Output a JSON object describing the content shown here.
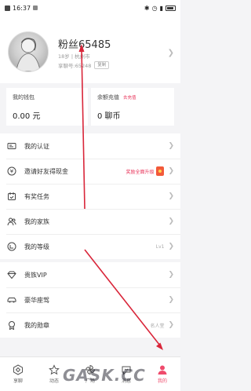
{
  "status_bar": {
    "time": "16:37"
  },
  "profile": {
    "nickname": "粉丝65485",
    "subinfo": "18岁 | 杭州市",
    "id_line": "享聊号:6​5248",
    "copy_label": "复制"
  },
  "wallet": {
    "title": "我的钱包",
    "value": "0.00 元"
  },
  "recharge": {
    "title": "余额充值",
    "tag": "去充值",
    "value": "0 聊币"
  },
  "menu_group_1": [
    {
      "label": "我的认证",
      "icon": "id-card-icon",
      "extra": ""
    },
    {
      "label": "邀请好友得现金",
      "icon": "yen-icon",
      "extra": "奖励全面升级"
    },
    {
      "label": "有奖任务",
      "icon": "calendar-icon",
      "extra": ""
    },
    {
      "label": "我的家族",
      "icon": "family-icon",
      "extra": ""
    },
    {
      "label": "我的等级",
      "icon": "level-icon",
      "extra": "Lv1"
    }
  ],
  "menu_group_2": [
    {
      "label": "贵族VIP",
      "icon": "diamond-icon",
      "extra": ""
    },
    {
      "label": "豪华座驾",
      "icon": "car-icon",
      "extra": ""
    },
    {
      "label": "我的勋章",
      "icon": "medal-icon",
      "extra": "名人堂"
    }
  ],
  "tabs": [
    {
      "label": "享聊",
      "icon": "hexagon-icon"
    },
    {
      "label": "动态",
      "icon": "star-icon"
    },
    {
      "label": "广场",
      "icon": "pinwheel-icon"
    },
    {
      "label": "消息",
      "icon": "message-icon"
    },
    {
      "label": "我的",
      "icon": "person-icon"
    }
  ],
  "colors": {
    "accent": "#ef4b6c",
    "annotation_arrow": "#d9263a"
  },
  "watermark": "GASK.CC"
}
